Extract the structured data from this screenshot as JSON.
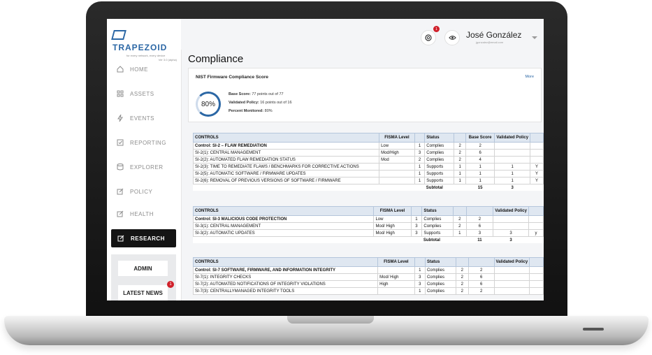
{
  "brand": {
    "name": "TRAPEZOID",
    "tagline": "for every network, every device",
    "version": "Ver 3.0 (alpha)"
  },
  "sidebar": {
    "items": [
      {
        "label": "HOME",
        "icon": "home-icon"
      },
      {
        "label": "ASSETS",
        "icon": "grid-icon"
      },
      {
        "label": "EVENTS",
        "icon": "bolt-icon"
      },
      {
        "label": "REPORTING",
        "icon": "checkbox-icon"
      },
      {
        "label": "EXPLORER",
        "icon": "database-icon"
      },
      {
        "label": "POLICY",
        "icon": "edit-icon"
      },
      {
        "label": "HEALTH",
        "icon": "edit-icon"
      },
      {
        "label": "RESEARCH",
        "icon": "edit-icon",
        "active": true
      }
    ],
    "admin_label": "ADMIN",
    "news_label": "LATEST NEWS",
    "news_badge": "1"
  },
  "topbar": {
    "notification_count": "1",
    "user_name": "José González",
    "user_email": "jgonzalez@email.com"
  },
  "page": {
    "title": "Compliance"
  },
  "score_card": {
    "title": "NIST Firmware Compliance Score",
    "more_label": "More",
    "percent": "80%",
    "percent_value": 0.8,
    "base_label": "Base Score:",
    "base_value": "77 points out of 77",
    "validated_label": "Validated Policy:",
    "validated_value": "16 points out of 16",
    "monitored_label": "Percent Monitored:",
    "monitored_value": "80%"
  },
  "tables": [
    {
      "headers": [
        "CONTROLS",
        "FISMA Level",
        "",
        "Status",
        "",
        "Base Score",
        "Validated Policy",
        ""
      ],
      "rows": [
        [
          "Control: SI-2 –  FLAW REMEDIATION",
          "Low",
          "1",
          "Complies",
          "2",
          "2",
          "",
          ""
        ],
        [
          "SI-2(1): CENTRAL MANAGEMENT",
          "Mod/High",
          "3",
          "Complies",
          "2",
          "6",
          "",
          ""
        ],
        [
          "SI-2(2): AUTOMATED FLAW REMEDIATION STATUS",
          "Mod",
          "2",
          "Complies",
          "2",
          "4",
          "",
          ""
        ],
        [
          "SI-2(3): TIME TO REMEDIATE FLAWS / BENCHMARKS FOR CORRECTIVE ACTIONS",
          "",
          "1",
          "Supports",
          "1",
          "1",
          "1",
          "Y"
        ],
        [
          "SI-2(5): AUTOMATIC SOFTWARE / FIRMWARE UPDATES",
          "",
          "1",
          "Supports",
          "1",
          "1",
          "1",
          "Y"
        ],
        [
          "SI-2(6): REMOVAL OF PREVIOUS VERSIONS OF SOFTWARE / FIRMWARE",
          "",
          "1",
          "Supports",
          "1",
          "1",
          "1",
          "Y"
        ]
      ],
      "subtotal_label": "Subtotal",
      "subtotal_base": "15",
      "subtotal_validated": "3"
    },
    {
      "headers": [
        "CONTROLS",
        "FISMA Level",
        "",
        "Status",
        "",
        "",
        "Validated Policy",
        ""
      ],
      "rows": [
        [
          "Control: SI-3 MALICIOUS CODE PROTECTION",
          "Low",
          "1",
          "Complies",
          "2",
          "2",
          "",
          ""
        ],
        [
          "SI-3(1): CENTRAL MANAGEMENT",
          "Mod/ High",
          "3",
          "Complies",
          "2",
          "6",
          "",
          ""
        ],
        [
          "SI-3(2): AUTOMATIC UPDATES",
          "Mod/ High",
          "3",
          "Supports",
          "1",
          "3",
          "3",
          "y"
        ]
      ],
      "subtotal_label": "Subtotal",
      "subtotal_base": "11",
      "subtotal_validated": "3"
    },
    {
      "headers": [
        "CONTROLS",
        "FISMA Level",
        "",
        "Status",
        "",
        "",
        "Validated Policy",
        ""
      ],
      "rows": [
        [
          "Control: SI-7 SOFTWARE, FIRMWARE, AND INFORMATION INTEGRITY",
          "",
          "1",
          "Complies",
          "2",
          "2",
          "",
          ""
        ],
        [
          "SI-7(1): INTEGRITY CHECKS",
          "Mod/ High",
          "3",
          "Complies",
          "2",
          "6",
          "",
          ""
        ],
        [
          "SI-7(2): AUTOMATED NOTIFICATIONS OF INTEGRITY VIOLATIONS",
          "High",
          "3",
          "Complies",
          "2",
          "6",
          "",
          ""
        ],
        [
          "SI-7(3): CENTRALLYMANAGED INTEGRITY TOOLS",
          "",
          "1",
          "Complies",
          "2",
          "2",
          "",
          ""
        ]
      ]
    }
  ]
}
